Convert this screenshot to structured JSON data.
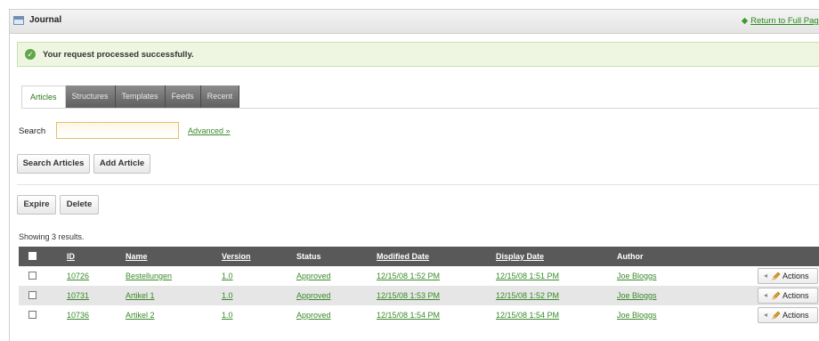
{
  "titlebar": {
    "title": "Journal",
    "return_link": "Return to Full Page"
  },
  "success": {
    "message": "Your request processed successfully."
  },
  "tabs": [
    {
      "label": "Articles",
      "active": true
    },
    {
      "label": "Structures"
    },
    {
      "label": "Templates"
    },
    {
      "label": "Feeds"
    },
    {
      "label": "Recent"
    }
  ],
  "search": {
    "label": "Search",
    "value": "",
    "advanced": "Advanced »"
  },
  "buttons": {
    "search_articles": "Search Articles",
    "add_article": "Add Article",
    "expire": "Expire",
    "delete": "Delete"
  },
  "results": {
    "summary": "Showing 3 results."
  },
  "table": {
    "headers": [
      "ID",
      "Name",
      "Version",
      "Status",
      "Modified Date",
      "Display Date",
      "Author"
    ],
    "rows": [
      {
        "id": "10726",
        "name": "Bestellungen",
        "version": "1.0",
        "status": "Approved",
        "modified": "12/15/08 1:52 PM",
        "display": "12/15/08 1:51 PM",
        "author": "Joe Bloggs",
        "action": "Actions"
      },
      {
        "id": "10731",
        "name": "Artikel 1",
        "version": "1.0",
        "status": "Approved",
        "modified": "12/15/08 1:53 PM",
        "display": "12/15/08 1:52 PM",
        "author": "Joe Bloggs",
        "action": "Actions"
      },
      {
        "id": "10736",
        "name": "Artikel 2",
        "version": "1.0",
        "status": "Approved",
        "modified": "12/15/08 1:54 PM",
        "display": "12/15/08 1:54 PM",
        "author": "Joe Bloggs",
        "action": "Actions"
      }
    ]
  },
  "colors": {
    "link": "#3a8a2a",
    "header_bg": "#595959",
    "success_bg": "#eef6e2"
  }
}
